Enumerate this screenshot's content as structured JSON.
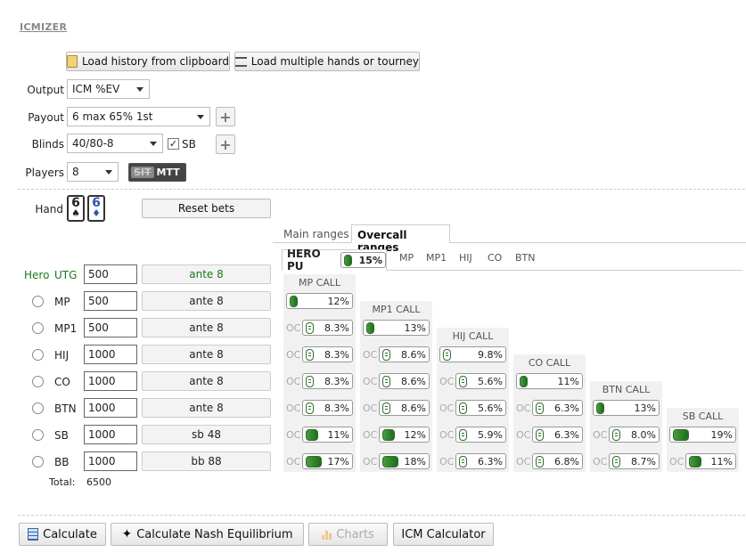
{
  "app_title": "ICMIZER",
  "buttons": {
    "load_history": "Load history from clipboard",
    "load_multiple": "Load multiple hands or tourney",
    "reset_bets": "Reset bets",
    "calculate": "Calculate",
    "calculate_nash": "Calculate Nash Equilibrium",
    "charts": "Charts",
    "icm_calculator": "ICM Calculator"
  },
  "settings": {
    "output_label": "Output",
    "output_value": "ICM %EV",
    "payout_label": "Payout",
    "payout_value": "6 max 65% 1st",
    "blinds_label": "Blinds",
    "blinds_value": "40/80-8",
    "sb_label": "SB",
    "sb_checked": true,
    "players_label": "Players",
    "players_value": "8",
    "toggle_off": "SIT",
    "toggle_on": "MTT"
  },
  "hand": {
    "label": "Hand",
    "card1_rank": "6",
    "card1_suit": "♠",
    "card1_color": "#111111",
    "card2_rank": "6",
    "card2_suit": "♦",
    "card2_color": "#3355aa"
  },
  "tabs": {
    "main": "Main ranges",
    "overcall": "Overcall ranges",
    "active": "overcall"
  },
  "subtabs": {
    "hero": "HERO PU",
    "hero_pct": "15%",
    "items": [
      "MP",
      "MP1",
      "HIJ",
      "CO",
      "BTN"
    ]
  },
  "players": [
    {
      "pos": "UTG",
      "hero": true,
      "hero_label": "Hero",
      "stack": "500",
      "bet": "ante 8"
    },
    {
      "pos": "MP",
      "stack": "500",
      "bet": "ante 8"
    },
    {
      "pos": "MP1",
      "stack": "500",
      "bet": "ante 8"
    },
    {
      "pos": "HIJ",
      "stack": "1000",
      "bet": "ante 8"
    },
    {
      "pos": "CO",
      "stack": "1000",
      "bet": "ante 8"
    },
    {
      "pos": "BTN",
      "stack": "1000",
      "bet": "ante 8"
    },
    {
      "pos": "SB",
      "stack": "1000",
      "bet": "sb 48"
    },
    {
      "pos": "BB",
      "stack": "1000",
      "bet": "bb 88"
    }
  ],
  "total_label": "Total:",
  "total_value": "6500",
  "oc_label": "OC",
  "call_columns": [
    {
      "title": "MP CALL",
      "main": "12%",
      "ocs": [
        "8.3%",
        "8.3%",
        "8.3%",
        "8.3%",
        "11%",
        "17%"
      ]
    },
    {
      "title": "MP1 CALL",
      "main": "13%",
      "ocs": [
        "8.6%",
        "8.6%",
        "8.6%",
        "12%",
        "18%"
      ]
    },
    {
      "title": "HIJ CALL",
      "main": "9.8%",
      "ocs": [
        "5.6%",
        "5.6%",
        "5.9%",
        "6.3%"
      ]
    },
    {
      "title": "CO CALL",
      "main": "11%",
      "ocs": [
        "6.3%",
        "6.3%",
        "6.8%"
      ]
    },
    {
      "title": "BTN CALL",
      "main": "13%",
      "ocs": [
        "8.0%",
        "8.7%"
      ]
    },
    {
      "title": "SB CALL",
      "main": "19%",
      "ocs": [
        "11%"
      ]
    }
  ],
  "colors": {
    "accent_green": "#2a7a2a",
    "hero_text": "#1a7a1a"
  }
}
